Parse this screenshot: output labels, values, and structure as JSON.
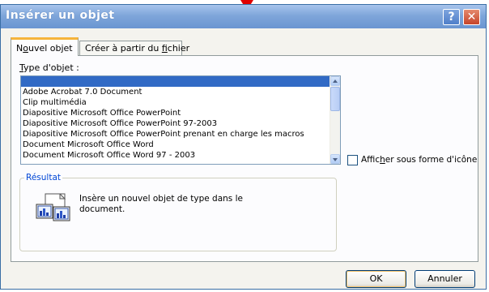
{
  "window": {
    "title": "Insérer un objet",
    "help_glyph": "?",
    "close_glyph": "✕"
  },
  "tabs": [
    {
      "pre": "N",
      "mnemonic": "o",
      "post": "uvel objet"
    },
    {
      "pre": "Créer à partir du ",
      "mnemonic": "f",
      "post": "ichier"
    }
  ],
  "object_type": {
    "label_pre": "",
    "label_mnemonic": "T",
    "label_post": "ype d'objet :",
    "items": [
      "",
      "Adobe Acrobat 7.0 Document",
      "Clip multimédia",
      "Diapositive Microsoft Office PowerPoint",
      "Diapositive Microsoft Office PowerPoint 97-2003",
      "Diapositive Microsoft Office PowerPoint prenant en charge les macros",
      "Document Microsoft Office Word",
      "Document Microsoft Office Word 97 - 2003"
    ]
  },
  "display_as_icon": {
    "pre": "Affic",
    "mnemonic": "h",
    "post": "er sous forme d'icône",
    "checked": false
  },
  "result": {
    "legend": "Résultat",
    "text": "Insère un nouvel objet de type  dans le document."
  },
  "buttons": {
    "ok": "OK",
    "cancel": "Annuler"
  },
  "colors": {
    "title_bar": "#7fa6da",
    "selection": "#316ac5",
    "active_tab_accent": "#f6b43a",
    "group_legend": "#0046d5",
    "pointer": "#e00000"
  },
  "icons": {
    "pointer": "red-down-triangle-icon",
    "help": "help-icon",
    "close": "close-icon",
    "result": "embedded-object-icon"
  }
}
